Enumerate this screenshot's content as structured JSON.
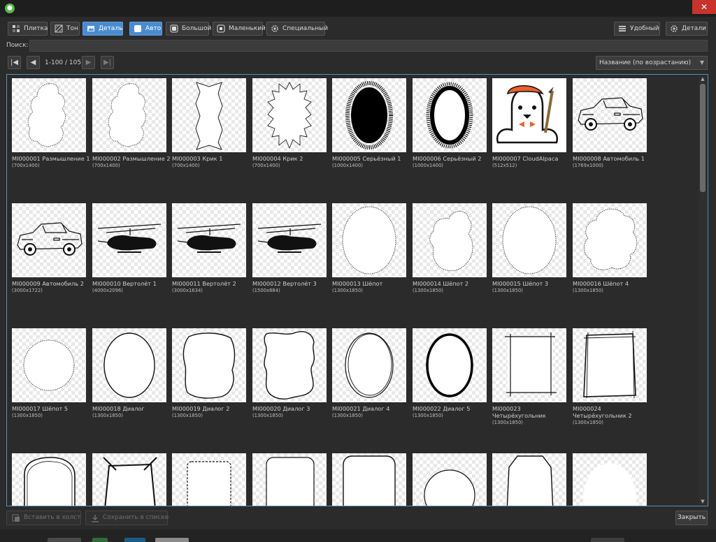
{
  "window": {
    "close_glyph": "✕"
  },
  "toolbar": {
    "tile": "Плитка",
    "tone": "Тон",
    "detail": "Деталь",
    "auto": "Авто",
    "large": "Большой",
    "small": "Маленький",
    "special": "Специальный",
    "convenient": "Удобный",
    "details": "Детали"
  },
  "search": {
    "label": "Поиск:",
    "value": "",
    "placeholder": ""
  },
  "pager": {
    "first": "|◀",
    "prev": "◀",
    "next": "▶",
    "last": "▶|",
    "info": "1-100 / 105",
    "sort": "Название (по возрастанию)"
  },
  "items": [
    {
      "name": "MI000001 Размышление 1",
      "size": "(700x1400)",
      "kind": "cloud"
    },
    {
      "name": "MI000002 Размышление 2",
      "size": "(700x1400)",
      "kind": "cloud"
    },
    {
      "name": "MI000003 Крик 1",
      "size": "(700x1400)",
      "kind": "shout"
    },
    {
      "name": "MI000004 Крик 2",
      "size": "(700x1400)",
      "kind": "spiky"
    },
    {
      "name": "MI000005 Серьёзный 1",
      "size": "(1000x1400)",
      "kind": "furry-solid"
    },
    {
      "name": "MI000006 Серьёзный 2",
      "size": "(1000x1400)",
      "kind": "furry-ring"
    },
    {
      "name": "MI000007 CloudAlpaca",
      "size": "(512x512)",
      "kind": "alpaca"
    },
    {
      "name": "MI000008 Автомобиль 1",
      "size": "(1769x1000)",
      "kind": "car"
    },
    {
      "name": "MI000009 Автомобиль 2",
      "size": "(3000x1722)",
      "kind": "car"
    },
    {
      "name": "MI000010 Вертолёт 1",
      "size": "(4000x2096)",
      "kind": "heli"
    },
    {
      "name": "MI000011 Вертолёт 2",
      "size": "(3000x1634)",
      "kind": "heli"
    },
    {
      "name": "MI000012 Вертолёт 3",
      "size": "(1500x884)",
      "kind": "heli"
    },
    {
      "name": "MI000013 Шёпот",
      "size": "(1300x1850)",
      "kind": "dotted-oval"
    },
    {
      "name": "MI000014 Шёпот 2",
      "size": "(1300x1850)",
      "kind": "dotted-blob"
    },
    {
      "name": "MI000015 Шёпот 3",
      "size": "(1300x1850)",
      "kind": "dotted-oval"
    },
    {
      "name": "MI000016 Шёпот 4",
      "size": "(1300x1850)",
      "kind": "dotted-cloud"
    },
    {
      "name": "MI000017 Шёпот 5",
      "size": "(1300x1850)",
      "kind": "dotted-circle"
    },
    {
      "name": "MI000018 Диалог",
      "size": "(1300x1850)",
      "kind": "oval"
    },
    {
      "name": "MI000019 Диалог 2",
      "size": "(1300x1850)",
      "kind": "wobbly"
    },
    {
      "name": "MI000020 Диалог 3",
      "size": "(1300x1850)",
      "kind": "wavy-rect"
    },
    {
      "name": "MI000021 Диалог 4",
      "size": "(1300x1850)",
      "kind": "double-oval"
    },
    {
      "name": "MI000022 Диалог 5",
      "size": "(1300x1850)",
      "kind": "thick-oval"
    },
    {
      "name": "MI000023 Четырёхугольник",
      "size": "(1300x1850)",
      "kind": "rect-sketch"
    },
    {
      "name": "MI000024 Четырёхугольник 2",
      "size": "(1300x1850)",
      "kind": "rect-sketch2"
    },
    {
      "name": "",
      "size": "",
      "kind": "arch"
    },
    {
      "name": "",
      "size": "",
      "kind": "trapezoid"
    },
    {
      "name": "",
      "size": "",
      "kind": "scallop"
    },
    {
      "name": "",
      "size": "",
      "kind": "rounded-rect"
    },
    {
      "name": "",
      "size": "",
      "kind": "rounded-rect2"
    },
    {
      "name": "",
      "size": "",
      "kind": "circle"
    },
    {
      "name": "",
      "size": "",
      "kind": "octagon"
    },
    {
      "name": "",
      "size": "",
      "kind": "white-oval"
    }
  ],
  "bottom": {
    "paste": "Вставить в холст",
    "save": "Сохранить в списке",
    "close": "Закрыть"
  },
  "colors": {
    "accent": "#4a8bd0",
    "background": "#2b2b2b",
    "frame": "#5b8fb5",
    "close": "#c8342c"
  }
}
